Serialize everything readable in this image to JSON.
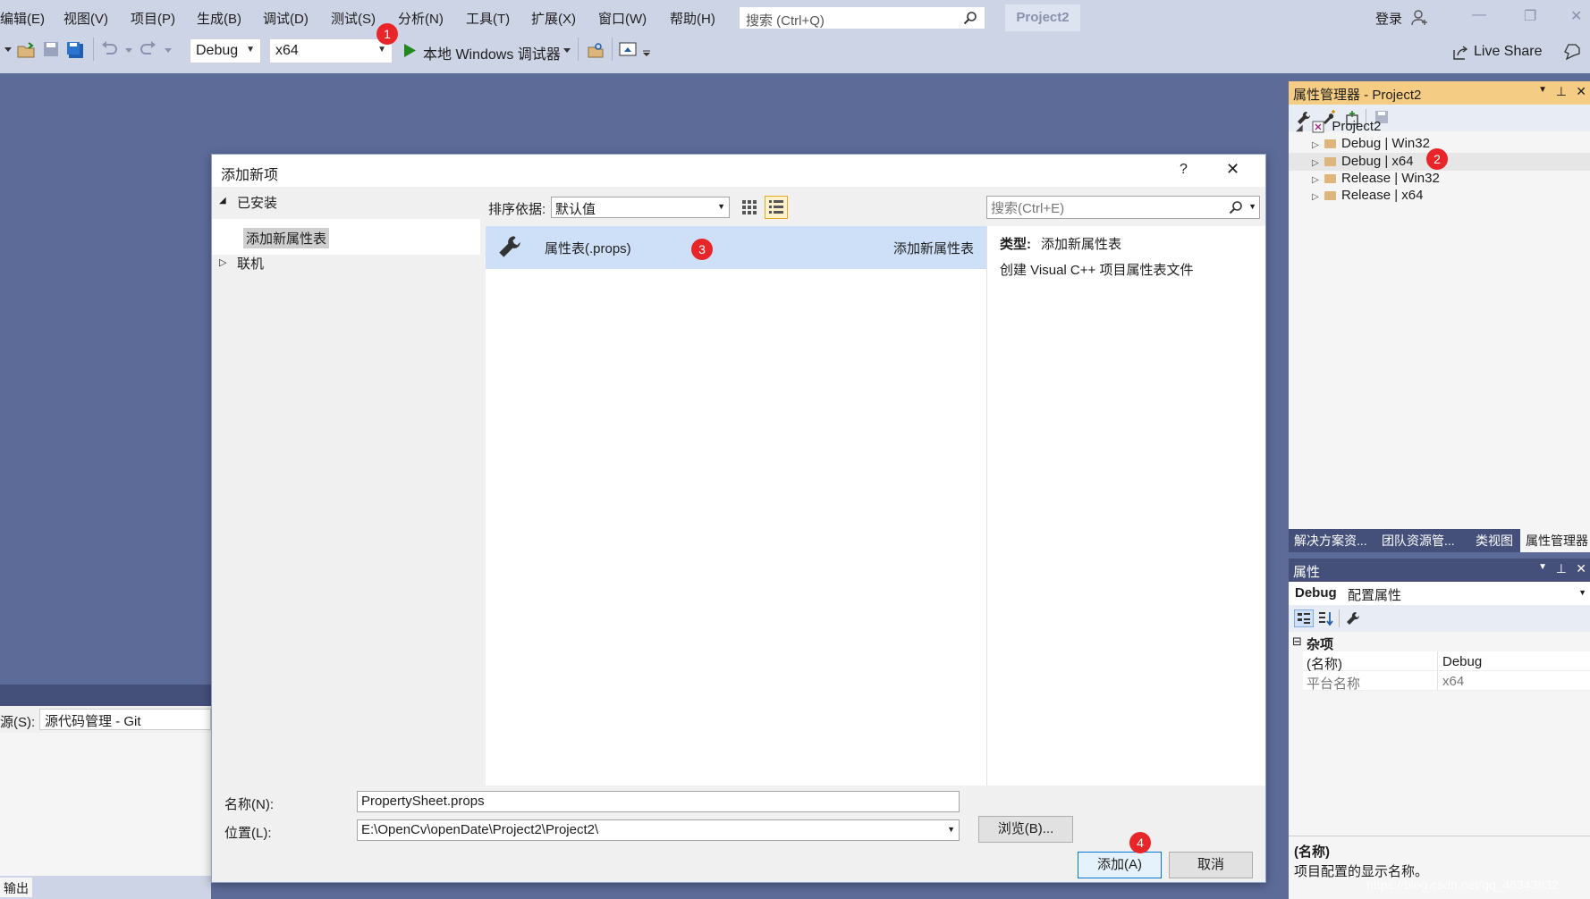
{
  "menubar": {
    "items": [
      "编辑(E)",
      "视图(V)",
      "项目(P)",
      "生成(B)",
      "调试(D)",
      "测试(S)",
      "分析(N)",
      "工具(T)",
      "扩展(X)",
      "窗口(W)",
      "帮助(H)"
    ],
    "search_placeholder": "搜索 (Ctrl+Q)",
    "project_name": "Project2",
    "login_label": "登录"
  },
  "toolbar": {
    "config": "Debug",
    "platform": "x64",
    "run_label": "本地 Windows 调试器",
    "live_share": "Live Share"
  },
  "property_manager": {
    "title": "属性管理器 - Project2",
    "root": "Project2",
    "items": [
      "Debug | Win32",
      "Debug | x64",
      "Release | Win32",
      "Release | x64"
    ]
  },
  "panel_tabs": [
    "解决方案资...",
    "团队资源管...",
    "类视图",
    "属性管理器"
  ],
  "properties": {
    "title": "属性",
    "object_bold": "Debug",
    "object_label": "配置属性",
    "category": "杂项",
    "rows": [
      {
        "name": "(名称)",
        "value": "Debug"
      },
      {
        "name": "平台名称",
        "value": "x64"
      }
    ],
    "desc_title": "(名称)",
    "desc_text": "项目配置的显示名称。"
  },
  "dialog": {
    "title": "添加新项",
    "help": "?",
    "close": "✕",
    "installed": "已安装",
    "installed_child": "添加新属性表",
    "online": "联机",
    "sort_label": "排序依据:",
    "sort_value": "默认值",
    "search_placeholder": "搜索(Ctrl+E)",
    "template_name": "属性表(.props)",
    "template_category": "添加新属性表",
    "type_label": "类型:",
    "type_value": "添加新属性表",
    "type_desc": "创建 Visual C++ 项目属性表文件",
    "name_label": "名称(N):",
    "name_value": "PropertySheet.props",
    "location_label": "位置(L):",
    "location_value": "E:\\OpenCv\\openDate\\Project2\\Project2\\",
    "browse_label": "浏览(B)...",
    "add_label": "添加(A)",
    "cancel_label": "取消"
  },
  "output": {
    "source_label": "源(S):",
    "source_value": "源代码管理 - Git",
    "tab_label": "输出"
  },
  "badges": [
    "1",
    "2",
    "3",
    "4"
  ],
  "watermark": "https://blog.csdn.net/qq_46343832"
}
